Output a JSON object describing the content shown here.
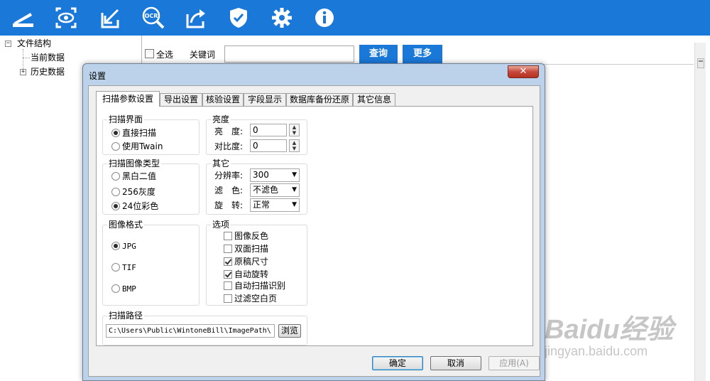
{
  "colors": {
    "toolbar_bg": "#1a78d8",
    "dialog_frame": "#bcd2ea",
    "close_button": "#c7483b"
  },
  "toolbar": {
    "icons": [
      "scan-icon",
      "eye-icon",
      "import-icon",
      "ocr-icon",
      "export-icon",
      "shield-icon",
      "gear-icon",
      "info-icon"
    ],
    "ocr_text": "OCR"
  },
  "tree": {
    "root": {
      "label": "文件结构",
      "expander": "⊟"
    },
    "children": [
      {
        "label": "当前数据"
      },
      {
        "label": "历史数据",
        "expander": "⊞"
      }
    ]
  },
  "search": {
    "select_all_label": "全选",
    "keyword_label": "关键词",
    "keyword_value": "",
    "query_button": "查询",
    "more_button": "更多"
  },
  "dialog": {
    "title": "设置",
    "close_label": "✕",
    "tabs": [
      {
        "label": "扫描参数设置",
        "active": true
      },
      {
        "label": "导出设置"
      },
      {
        "label": "核验设置"
      },
      {
        "label": "字段显示"
      },
      {
        "label": "数据库备份还原"
      },
      {
        "label": "其它信息"
      }
    ],
    "scan_interface": {
      "title": "扫描界面",
      "options": [
        {
          "label": "直接扫描",
          "selected": true
        },
        {
          "label": "使用Twain",
          "selected": false
        }
      ]
    },
    "brightness": {
      "title": "亮度",
      "brightness_label": "亮　度:",
      "brightness_value": "0",
      "contrast_label": "对比度:",
      "contrast_value": "0"
    },
    "image_type": {
      "title": "扫描图像类型",
      "options": [
        {
          "label": "黑白二值",
          "selected": false
        },
        {
          "label": "256灰度",
          "selected": false
        },
        {
          "label": "24位彩色",
          "selected": true
        }
      ]
    },
    "other": {
      "title": "其它",
      "resolution_label": "分辨率:",
      "resolution_value": "300",
      "filter_label": "滤　色:",
      "filter_value": "不滤色",
      "rotate_label": "旋　转:",
      "rotate_value": "正常"
    },
    "image_format": {
      "title": "图像格式",
      "options": [
        {
          "label": "JPG",
          "selected": true
        },
        {
          "label": "TIF",
          "selected": false
        },
        {
          "label": "BMP",
          "selected": false
        }
      ]
    },
    "options": {
      "title": "选项",
      "items": [
        {
          "label": "图像反色",
          "checked": false
        },
        {
          "label": "双面扫描",
          "checked": false
        },
        {
          "label": "原稿尺寸",
          "checked": true
        },
        {
          "label": "自动旋转",
          "checked": true
        },
        {
          "label": "自动扫描识别",
          "checked": false
        },
        {
          "label": "过滤空白页",
          "checked": false
        }
      ]
    },
    "scan_path": {
      "title": "扫描路径",
      "value": "C:\\Users\\Public\\WintoneBill\\ImagePath\\",
      "browse_label": "浏览"
    },
    "buttons": {
      "ok": "确定",
      "cancel": "取消",
      "apply": "应用(A)"
    }
  },
  "watermark": {
    "brand": "Baidu经验",
    "url": "jingyan.baidu.com"
  }
}
